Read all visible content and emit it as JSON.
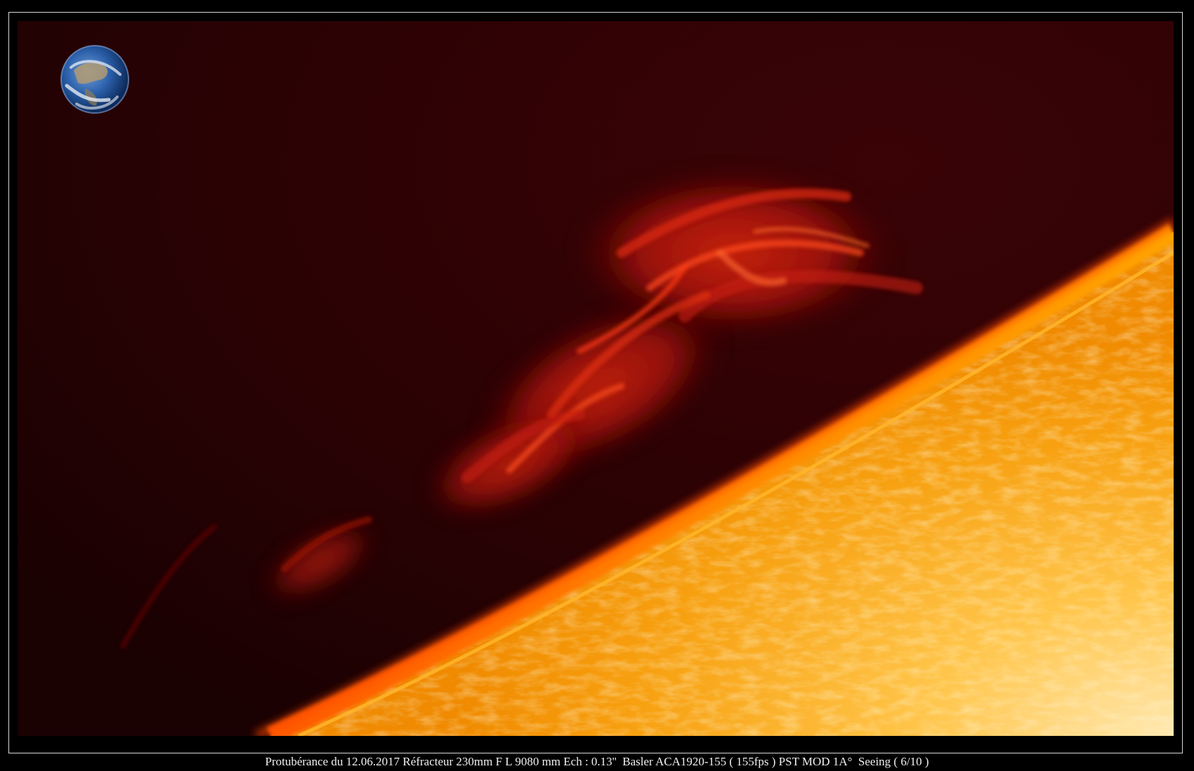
{
  "caption": "Protubérance du 12.06.2017 Réfracteur 230mm F L 9080 mm Ech : 0.13''  Basler ACA1920-155 ( 155fps ) PST MOD 1A°  Seeing ( 6/10 )",
  "colors": {
    "sky": "#2a0204",
    "prominence": "#c0180c",
    "limb": "#ff9a00",
    "disk": "#f7a616",
    "disk_highlight": "#ffe6a8",
    "earth_ocean": "#1e4e9c",
    "earth_cloud": "#f2f4f8",
    "frame_border": "#d8d8d8",
    "caption_text": "#f0f0f0"
  }
}
